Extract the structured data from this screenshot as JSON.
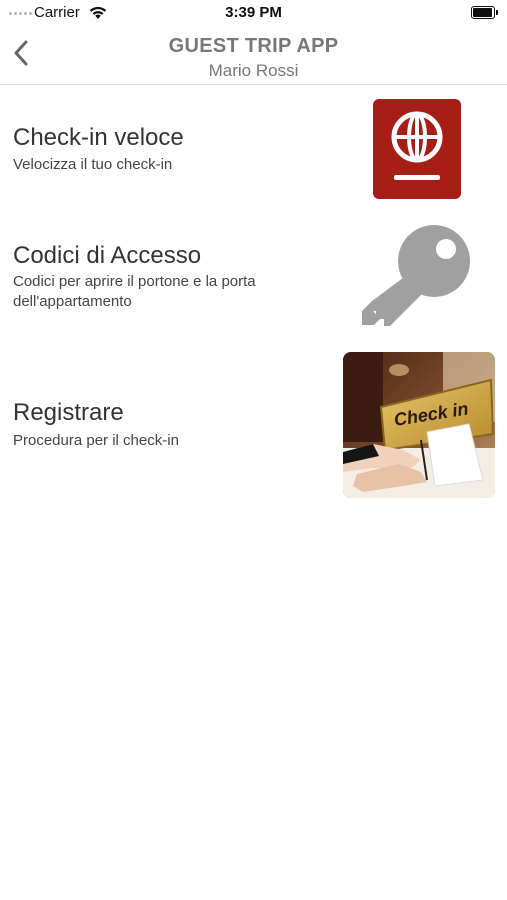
{
  "status_bar": {
    "carrier": "Carrier",
    "time": "3:39 PM",
    "icons": [
      "signal-dots-icon",
      "wifi-icon",
      "battery-icon"
    ]
  },
  "nav": {
    "title": "GUEST TRIP APP",
    "subtitle": "Mario Rossi",
    "back_icon": "chevron-left-icon"
  },
  "menu": {
    "items": [
      {
        "title": "Check-in veloce",
        "description": "Velocizza il tuo check-in",
        "icon": "passport-icon",
        "icon_color": "#a61e16"
      },
      {
        "title": "Codici di Accesso",
        "description": "Codici per aprire il portone e la porta dell'appartamento",
        "icon": "key-icon",
        "icon_color": "#a0a0a0"
      },
      {
        "title": "Registrare",
        "description": "Procedura per il check-in",
        "icon": "check-in-photo",
        "sign_text": "Check in"
      }
    ]
  }
}
